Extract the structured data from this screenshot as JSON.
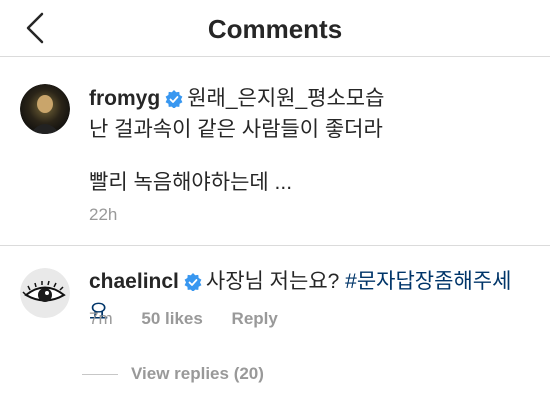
{
  "header": {
    "title": "Comments",
    "back_icon": "chevron-left-icon"
  },
  "comments": [
    {
      "username": "fromyg",
      "verified": true,
      "line1": "원래_은지원_평소모습",
      "line2": "난 걸과속이 같은 사람들이 좋더라",
      "line3": "빨리 녹음해야하는데 ...",
      "time": "22h"
    },
    {
      "username": "chaelincl",
      "verified": true,
      "text": "사장님 저는요?",
      "hashtag": "#문자답장좀해주세요",
      "time": "7m",
      "likes": "50 likes",
      "reply_label": "Reply",
      "view_replies": "View replies (20)"
    }
  ],
  "colors": {
    "verified_badge": "#3897f0",
    "hashtag": "#003569",
    "meta_text": "#999999"
  }
}
